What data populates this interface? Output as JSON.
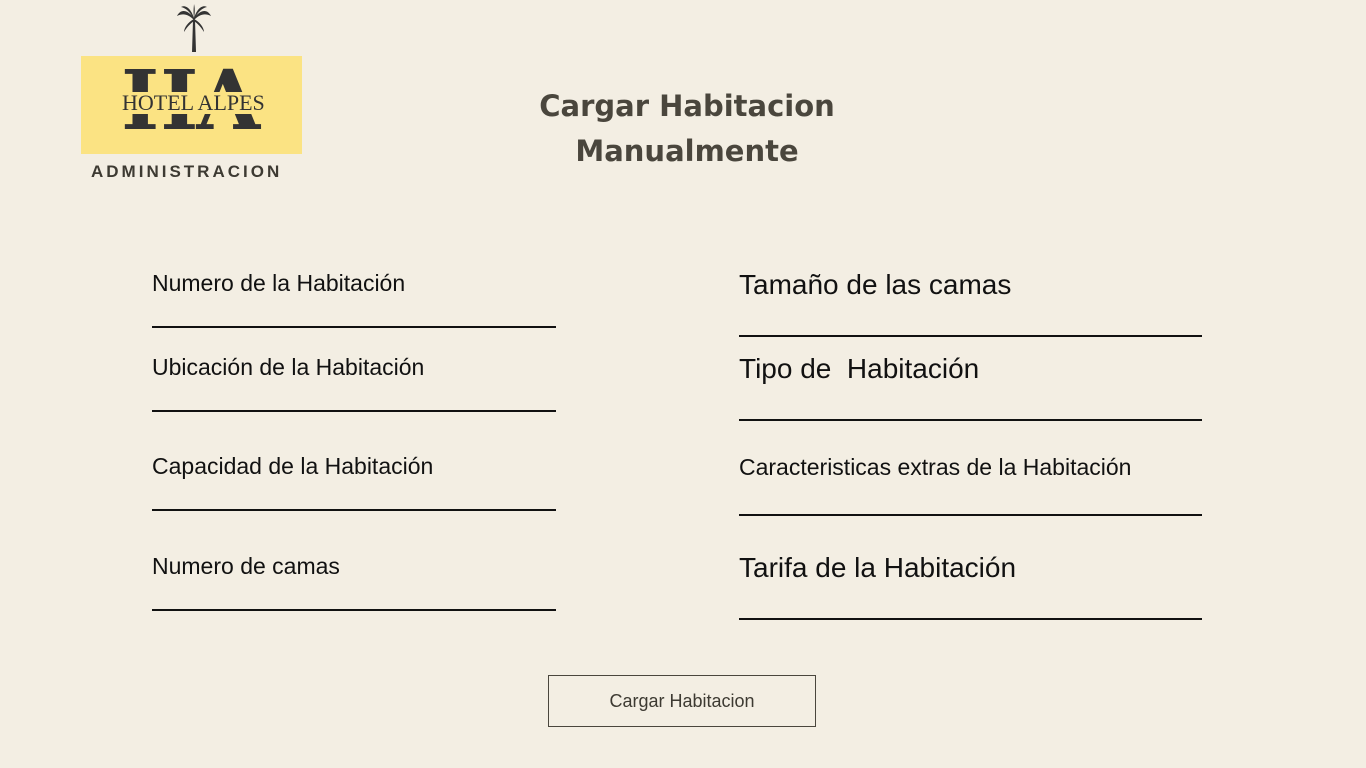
{
  "brand": {
    "logo_letters": "HA",
    "hotel_name": "HOTEL ALPES",
    "subtitle": "ADMINISTRACION",
    "logo_color": "#fbe383"
  },
  "title": {
    "line1": "Cargar Habitacion",
    "line2": "Manualmente"
  },
  "fields_left": [
    {
      "label": "Numero de la Habitación",
      "value": ""
    },
    {
      "label": "Ubicación de la Habitación",
      "value": ""
    },
    {
      "label": "Capacidad de la Habitación",
      "value": ""
    },
    {
      "label": "Numero de camas",
      "value": ""
    }
  ],
  "fields_right": [
    {
      "label": "Tamaño de las camas",
      "value": ""
    },
    {
      "label": "Tipo de  Habitación",
      "value": ""
    },
    {
      "label": "Caracteristicas extras de la Habitación",
      "value": ""
    },
    {
      "label": "Tarifa de la Habitación",
      "value": ""
    }
  ],
  "submit": {
    "label": "Cargar Habitacion"
  },
  "colors": {
    "background": "#f3eee3",
    "text": "#111111",
    "title": "#4a463d"
  }
}
